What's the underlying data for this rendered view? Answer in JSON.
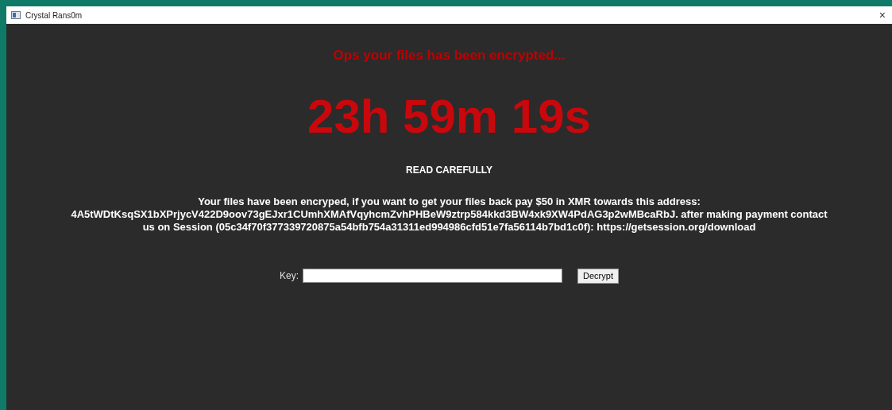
{
  "window": {
    "title": "Crystal Rans0m",
    "close": "×"
  },
  "heading": "Ops your files has been encrypted...",
  "timer": "23h 59m 19s",
  "notice": "READ CAREFULLY",
  "message_lines": [
    "Your files have been encryped, if you want to get your files back pay $50 in XMR towards this address:",
    "4A5tWDtKsqSX1bXPrjycV422D9oov73gEJxr1CUmhXMAfVqyhcmZvhPHBeW9ztrp584kkd3BW4xk9XW4PdAG3p2wMBcaRbJ. after making payment contact",
    "us on Session (05c34f70f377339720875a54bfb754a31311ed994986cfd51e7fa56114b7bd1c0f): https://getsession.org/download"
  ],
  "key_form": {
    "label": "Key:",
    "button": "Decrypt"
  }
}
